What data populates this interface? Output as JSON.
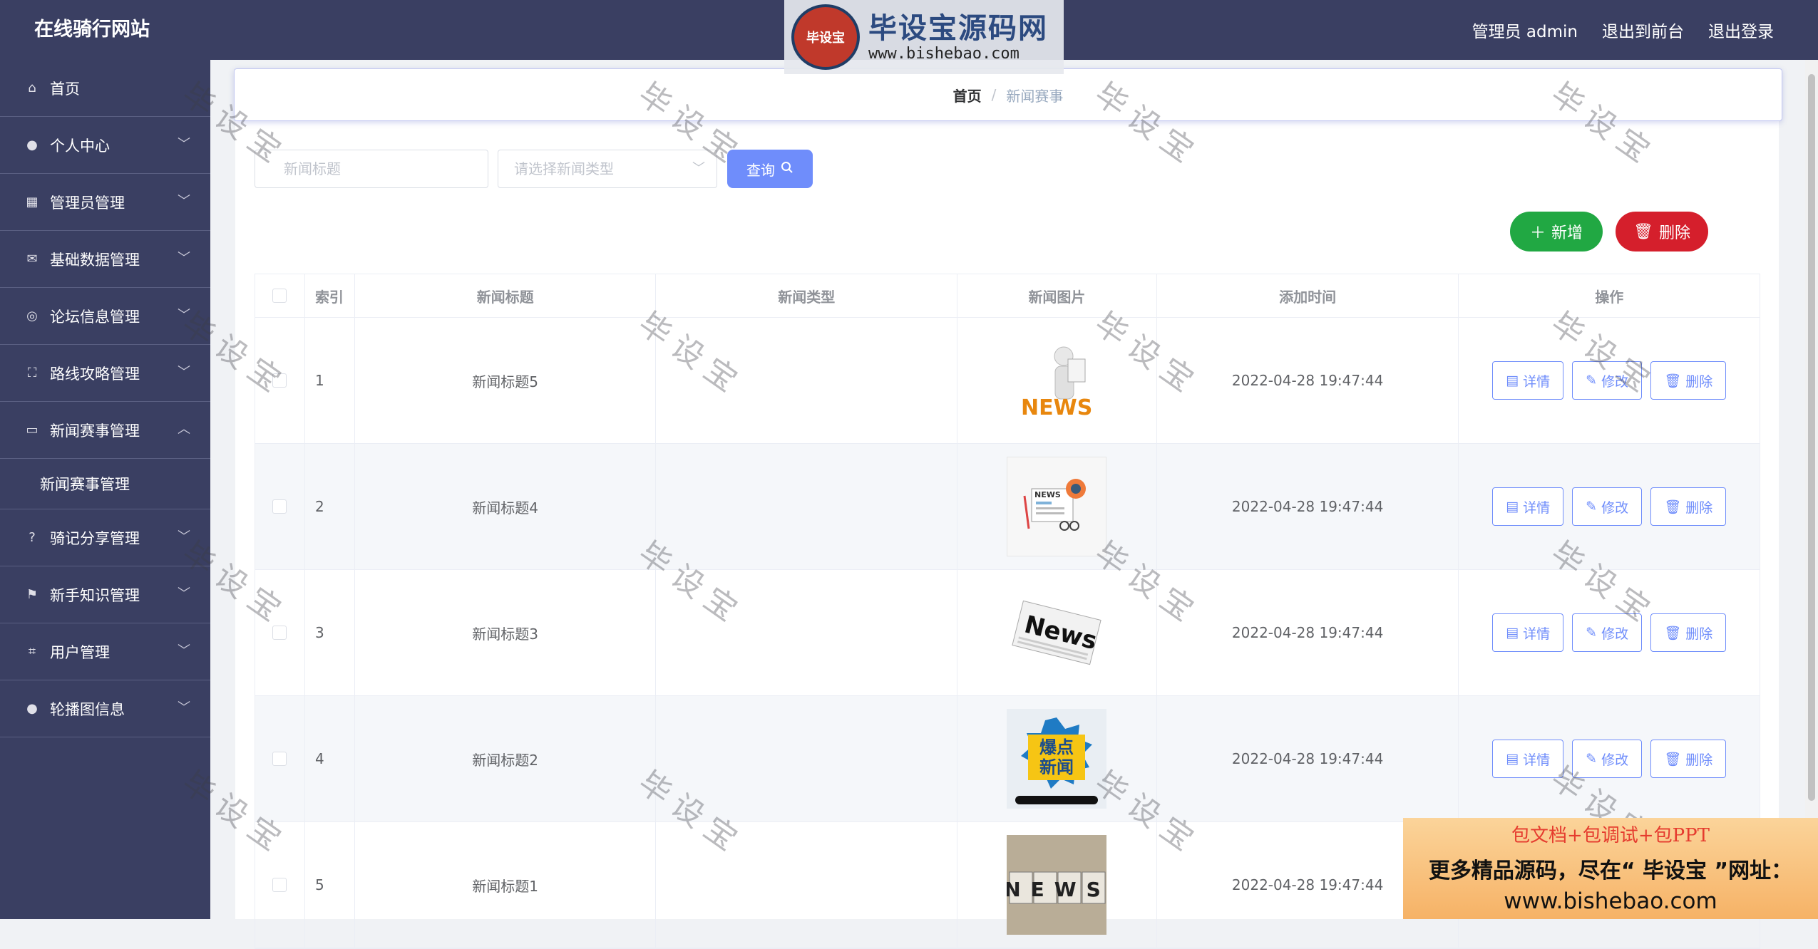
{
  "header": {
    "site_title": "在线骑行网站",
    "admin_label": "管理员 admin",
    "back_front": "退出到前台",
    "logout": "退出登录"
  },
  "banner": {
    "badge": "毕设宝",
    "name": "毕设宝源码网",
    "url": "www.bishebao.com"
  },
  "sidebar": {
    "items": [
      {
        "label": "首页",
        "icon": "home-icon"
      },
      {
        "label": "个人中心",
        "icon": "user-icon"
      },
      {
        "label": "管理员管理",
        "icon": "grid-icon"
      },
      {
        "label": "基础数据管理",
        "icon": "mail-icon"
      },
      {
        "label": "论坛信息管理",
        "icon": "compass-icon"
      },
      {
        "label": "路线攻略管理",
        "icon": "fullscreen-icon"
      },
      {
        "label": "新闻赛事管理",
        "icon": "chat-icon"
      },
      {
        "label": "骑记分享管理",
        "icon": "help-icon"
      },
      {
        "label": "新手知识管理",
        "icon": "flag-icon"
      },
      {
        "label": "用户管理",
        "icon": "crop-icon"
      },
      {
        "label": "轮播图信息",
        "icon": "user-icon"
      }
    ],
    "submenu": "新闻赛事管理"
  },
  "breadcrumb": {
    "home": "首页",
    "sep": "/",
    "current": "新闻赛事"
  },
  "search": {
    "title_placeholder": "新闻标题",
    "type_placeholder": "请选择新闻类型",
    "query_label": "查询"
  },
  "actions": {
    "add": "新增",
    "delete": "删除"
  },
  "table": {
    "headers": [
      "索引",
      "新闻标题",
      "新闻类型",
      "新闻图片",
      "添加时间",
      "操作"
    ],
    "rows": [
      {
        "index": "1",
        "title": "新闻标题5",
        "type": "",
        "time": "2022-04-28 19:47:44"
      },
      {
        "index": "2",
        "title": "新闻标题4",
        "type": "",
        "time": "2022-04-28 19:47:44"
      },
      {
        "index": "3",
        "title": "新闻标题3",
        "type": "",
        "time": "2022-04-28 19:47:44"
      },
      {
        "index": "4",
        "title": "新闻标题2",
        "type": "",
        "time": "2022-04-28 19:47:44"
      },
      {
        "index": "5",
        "title": "新闻标题1",
        "type": "",
        "time": "2022-04-28 19:47:44"
      }
    ],
    "ops": {
      "detail": "详情",
      "edit": "修改",
      "remove": "删除"
    }
  },
  "images": {
    "news_word": "NEWS",
    "news_word2": "News",
    "hot_news": "爆点新闻"
  },
  "watermark": "毕设宝",
  "ad": {
    "line1": "包文档+包调试+包PPT",
    "line2": "更多精品源码，尽在“ 毕设宝 ”网址：",
    "line3": "www.bishebao.com"
  }
}
